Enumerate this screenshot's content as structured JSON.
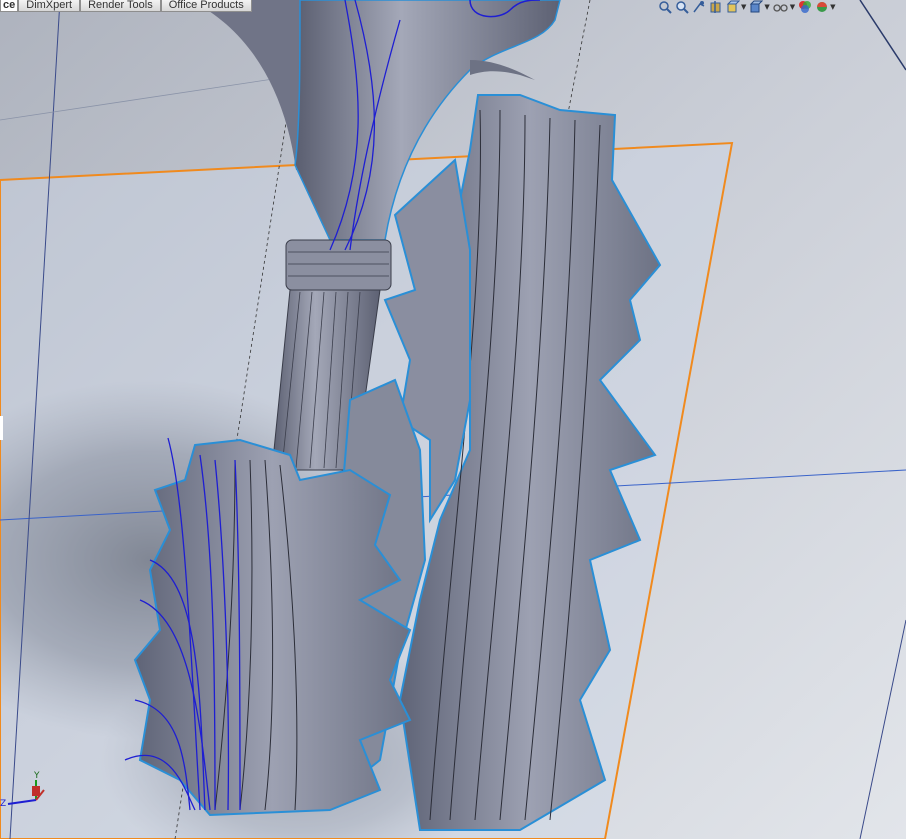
{
  "command_manager": {
    "tabs": [
      {
        "label": "ce",
        "active": true
      },
      {
        "label": "DimXpert",
        "active": false
      },
      {
        "label": "Render Tools",
        "active": false
      },
      {
        "label": "Office Products",
        "active": false
      }
    ]
  },
  "heads_up_toolbar": {
    "icons": [
      "zoom-to-fit-icon",
      "zoom-to-area-icon",
      "previous-view-icon",
      "section-view-icon",
      "view-orientation-icon",
      "display-style-icon",
      "hide-show-items-icon",
      "edit-appearance-icon",
      "apply-scene-icon"
    ]
  },
  "triad": {
    "y_label": "Y",
    "z_label": "Z"
  },
  "colors": {
    "model": "#7f8496",
    "edge_highlight": "#2a8fd6",
    "sketch_curve": "#1e1ed2",
    "plane_border": "#f08a1e",
    "background_top": "#b9bfc9"
  }
}
